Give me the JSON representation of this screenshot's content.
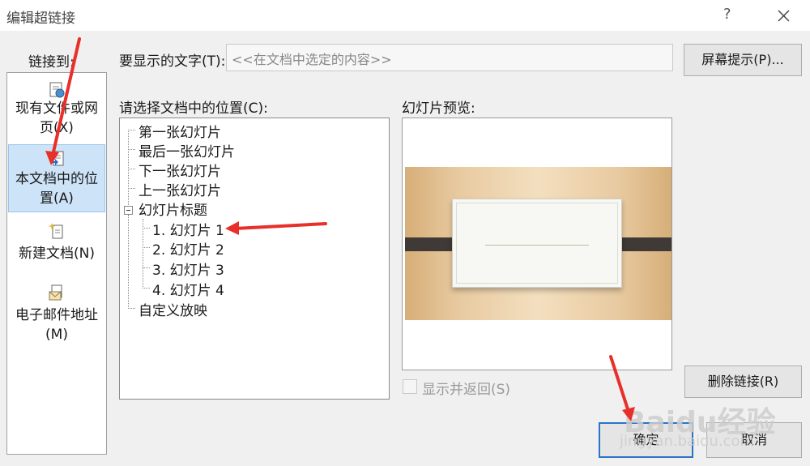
{
  "window": {
    "title": "编辑超链接",
    "help": "?"
  },
  "link_to": {
    "label": "链接到:",
    "items": [
      {
        "line1": "现有文件或网",
        "line2": "页(X)",
        "icon": "web-page-icon"
      },
      {
        "line1": "本文档中的位",
        "line2": "置(A)",
        "icon": "document-place-icon",
        "selected": true
      },
      {
        "line1": "新建文档(N)",
        "line2": "",
        "icon": "new-document-icon"
      },
      {
        "line1": "电子邮件地址",
        "line2": "(M)",
        "icon": "email-icon"
      }
    ]
  },
  "display_text": {
    "label": "要显示的文字(T):",
    "value": "<<在文档中选定的内容>>"
  },
  "screen_tip_button": "屏幕提示(P)...",
  "place": {
    "label": "请选择文档中的位置(C):",
    "tree": [
      "第一张幻灯片",
      "最后一张幻灯片",
      "下一张幻灯片",
      "上一张幻灯片",
      "幻灯片标题",
      "1. 幻灯片 1",
      "2. 幻灯片 2",
      "3. 幻灯片 3",
      "4. 幻灯片 4",
      "自定义放映"
    ]
  },
  "preview": {
    "label": "幻灯片预览:",
    "show_and_return": "显示并返回(S)"
  },
  "buttons": {
    "remove_link": "删除链接(R)",
    "ok": "确定",
    "cancel": "取消"
  },
  "watermark": {
    "text": "Baidu经验",
    "sub": "jingyan.baidu.com"
  },
  "colors": {
    "annotation_red": "#e8302a",
    "selection_blue": "#cde3f7",
    "default_button_border": "#2b73c9"
  }
}
